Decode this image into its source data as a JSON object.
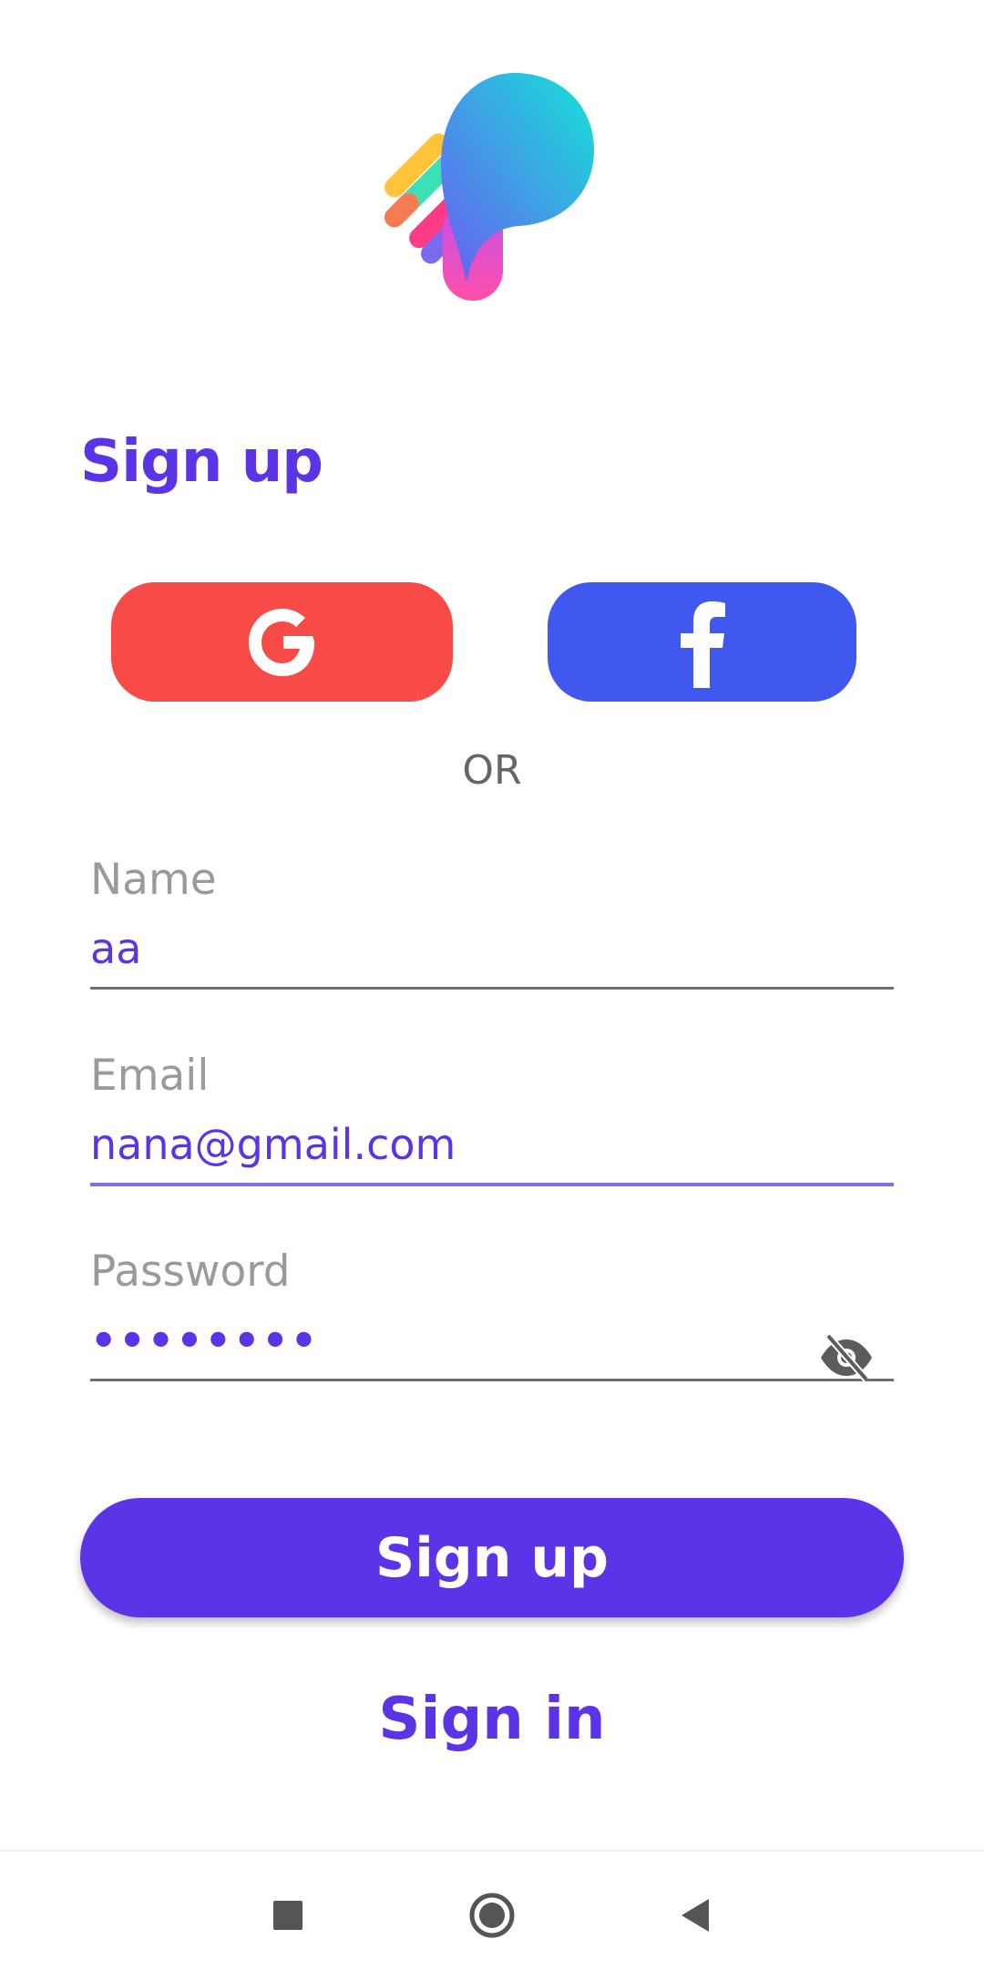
{
  "header": {
    "title": "Sign up"
  },
  "social": {
    "google_icon": "google-g",
    "facebook_icon": "facebook-f"
  },
  "divider_text": "OR",
  "form": {
    "name": {
      "label": "Name",
      "value": "aa"
    },
    "email": {
      "label": "Email",
      "value": "nana@gmail.com"
    },
    "password": {
      "label": "Password",
      "value": "••••••••",
      "toggle_icon": "eye-off-icon"
    }
  },
  "actions": {
    "signup_label": "Sign up",
    "signin_label": "Sign in"
  },
  "colors": {
    "primary": "#5a34e6",
    "google": "#f84b48",
    "facebook": "#4158ef"
  }
}
